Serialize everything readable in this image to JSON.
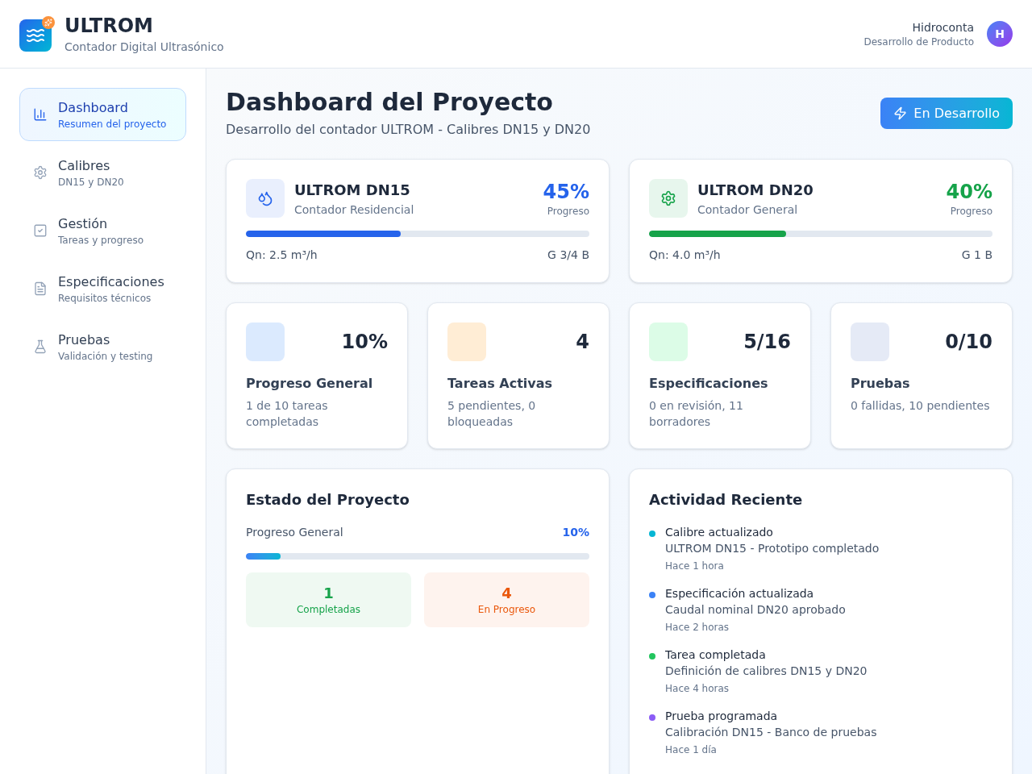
{
  "header": {
    "title": "ULTROM",
    "subtitle": "Contador Digital Ultrasónico",
    "user": {
      "name": "Hidroconta",
      "role": "Desarrollo de Producto",
      "initial": "H"
    }
  },
  "sidebar": {
    "items": [
      {
        "label": "Dashboard",
        "sublabel": "Resumen del proyecto",
        "selected": true
      },
      {
        "label": "Calibres",
        "sublabel": "DN15 y DN20",
        "selected": false
      },
      {
        "label": "Gestión",
        "sublabel": "Tareas y progreso",
        "selected": false
      },
      {
        "label": "Especificaciones",
        "sublabel": "Requisitos técnicos",
        "selected": false
      },
      {
        "label": "Pruebas",
        "sublabel": "Validación y testing",
        "selected": false
      }
    ]
  },
  "page": {
    "title": "Dashboard del Proyecto",
    "subtitle": "Desarrollo del contador ULTROM - Calibres DN15 y DN20",
    "status_button": "En Desarrollo"
  },
  "meters": [
    {
      "name": "ULTROM DN15",
      "type": "Contador Residencial",
      "percent": "45%",
      "percent_label": "Progreso",
      "level": 0.45,
      "color": "#2563eb",
      "flow": "Qn: 2.5 m³/h",
      "size": "G 3/4 B"
    },
    {
      "name": "ULTROM DN20",
      "type": "Contador General",
      "percent": "40%",
      "percent_label": "Progreso",
      "level": 0.4,
      "color": "#16a34a",
      "flow": "Qn: 4.0 m³/h",
      "size": "G 1 B"
    }
  ],
  "stats": [
    {
      "value": "10%",
      "title": "Progreso General",
      "detail": "1 de 10 tareas completadas",
      "color": "#dbeafe"
    },
    {
      "value": "4",
      "title": "Tareas Activas",
      "detail": "5 pendientes, 0 bloqueadas",
      "color": "#ffedd5"
    },
    {
      "value": "5/16",
      "title": "Especificaciones",
      "detail": "0 en revisión, 11 borradores",
      "color": "#dcfce7"
    },
    {
      "value": "0/10",
      "title": "Pruebas",
      "detail": "0 fallidas, 10 pendientes",
      "color": "#e5eaf6"
    }
  ],
  "status_panel": {
    "title": "Estado del Proyecto",
    "progress_label": "Progreso General",
    "progress_value": "10%",
    "level": 0.1,
    "counters": [
      {
        "value": "1",
        "label": "Completadas",
        "color": "#16a34a"
      },
      {
        "value": "4",
        "label": "En Progreso",
        "color": "#ea580c"
      }
    ]
  },
  "activity": {
    "title": "Actividad Reciente",
    "items": [
      {
        "title": "Calibre actualizado",
        "detail": "ULTROM DN15 - Prototipo completado",
        "time": "Hace 1 hora",
        "color": "#06b6d4"
      },
      {
        "title": "Especificación actualizada",
        "detail": "Caudal nominal DN20 aprobado",
        "time": "Hace 2 horas",
        "color": "#3b82f6"
      },
      {
        "title": "Tarea completada",
        "detail": "Definición de calibres DN15 y DN20",
        "time": "Hace 4 horas",
        "color": "#22c55e"
      },
      {
        "title": "Prueba programada",
        "detail": "Calibración DN15 - Banco de pruebas",
        "time": "Hace 1 día",
        "color": "#8b5cf6"
      }
    ]
  }
}
